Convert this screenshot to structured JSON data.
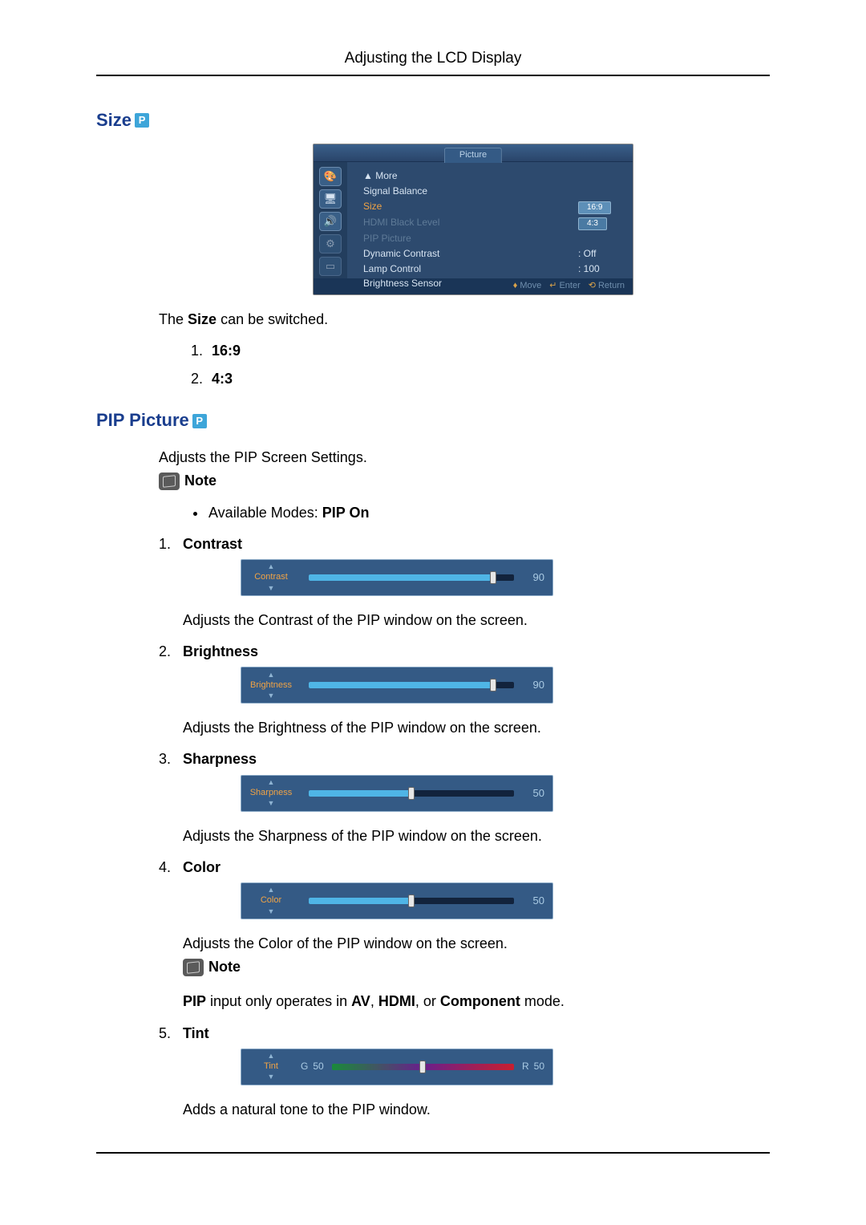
{
  "pageTitle": "Adjusting the LCD Display",
  "pIconText": "P",
  "sizeSection": {
    "title": "Size",
    "osd": {
      "tabTitle": "Picture",
      "rows": {
        "more": "▲ More",
        "signalBalance": "Signal Balance",
        "size": "Size",
        "sizeVal1": "16:9",
        "sizeVal2": "4:3",
        "hdmiBlack": "HDMI Black Level",
        "pipPicture": "PIP Picture",
        "dynContrast": "Dynamic Contrast",
        "dynContrastVal": ": Off",
        "lampControl": "Lamp Control",
        "lampControlVal": ": 100",
        "brightnessSensor": "Brightness Sensor"
      },
      "footer": {
        "move": "Move",
        "enter": "Enter",
        "ret": "Return"
      },
      "iconGlyphs": {
        "a": "🎨",
        "b": "🖥",
        "c": "🔊",
        "d": "⚙",
        "e": "▭"
      }
    },
    "intro_pre": "The ",
    "intro_bold": "Size",
    "intro_post": " can be switched.",
    "items": {
      "i1": "16:9",
      "i2": "4:3"
    }
  },
  "pipSection": {
    "title": "PIP Picture",
    "intro": "Adjusts the PIP Screen Settings.",
    "note1Label": "Note",
    "bullet_pre": "Available Modes: ",
    "bullet_bold": "PIP On",
    "items": {
      "contrast": {
        "label": "Contrast",
        "sliderLabel": "Contrast",
        "value": "90",
        "percent": 90,
        "desc": "Adjusts the Contrast of the PIP window on the screen."
      },
      "brightness": {
        "label": "Brightness",
        "sliderLabel": "Brightness",
        "value": "90",
        "percent": 90,
        "desc": "Adjusts the Brightness of the PIP window on the screen."
      },
      "sharpness": {
        "label": "Sharpness",
        "sliderLabel": "Sharpness",
        "value": "50",
        "percent": 50,
        "desc": "Adjusts the Sharpness of the PIP window on the screen."
      },
      "color": {
        "label": "Color",
        "sliderLabel": "Color",
        "value": "50",
        "percent": 50,
        "desc": "Adjusts the Color of the PIP window on the screen.",
        "noteLabel": "Note",
        "note_b1": "PIP",
        "note_t1": " input only operates in ",
        "note_b2": "AV",
        "note_t2": ", ",
        "note_b3": "HDMI",
        "note_t3": ", or ",
        "note_b4": "Component",
        "note_t4": " mode."
      },
      "tint": {
        "label": "Tint",
        "sliderLabel": "Tint",
        "gLabel": "G",
        "gVal": "50",
        "rLabel": "R",
        "rVal": "50",
        "percent": 50,
        "desc": "Adds a natural tone to the PIP window."
      }
    }
  }
}
